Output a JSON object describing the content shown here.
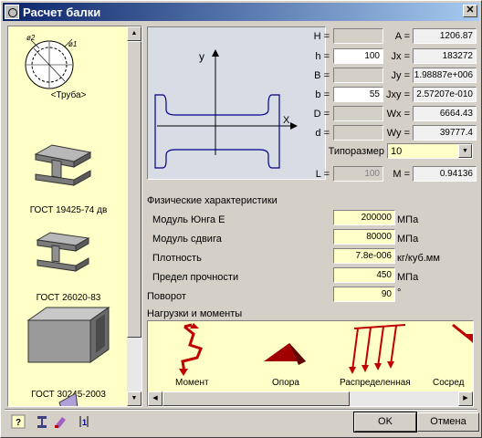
{
  "window": {
    "title": "Расчет балки"
  },
  "profiles": [
    {
      "label": "<Труба>",
      "icon": "pipe-section-icon",
      "dims": [
        "ø2",
        "ø1"
      ]
    },
    {
      "label": "ГОСТ 19425-74 дв",
      "icon": "i-beam-19425-icon"
    },
    {
      "label": "ГОСТ 26020-83",
      "icon": "i-beam-26020-icon"
    },
    {
      "label": "ГОСТ 30245-2003",
      "icon": "rect-tube-icon"
    }
  ],
  "preview": {
    "axis_x": "X",
    "axis_y": "y"
  },
  "dims": {
    "H": {
      "label": "H =",
      "value": ""
    },
    "h": {
      "label": "h =",
      "value": "100"
    },
    "B": {
      "label": "B =",
      "value": ""
    },
    "b": {
      "label": "b =",
      "value": "55"
    },
    "D": {
      "label": "D =",
      "value": ""
    },
    "d": {
      "label": "d =",
      "value": ""
    }
  },
  "props": {
    "A": {
      "label": "A =",
      "value": "1206.87"
    },
    "Jx": {
      "label": "Jx =",
      "value": "183272"
    },
    "Jy": {
      "label": "Jy =",
      "value": "1.98887e+006"
    },
    "Jxy": {
      "label": "Jxy =",
      "value": "2.57207e-010"
    },
    "Wx": {
      "label": "Wx =",
      "value": "6664.43"
    },
    "Wy": {
      "label": "Wy =",
      "value": "39777.4"
    }
  },
  "size": {
    "label": "Типоразмер",
    "value": "10"
  },
  "L": {
    "label": "L =",
    "value": "100"
  },
  "M": {
    "label": "M =",
    "value": "0.94136"
  },
  "physical": {
    "title": "Физические характеристики",
    "rows": [
      {
        "label": "Модуль Юнга E",
        "value": "200000",
        "unit": "МПа"
      },
      {
        "label": "Модуль сдвига",
        "value": "80000",
        "unit": "МПа"
      },
      {
        "label": "Плотность",
        "value": "7.8e-006",
        "unit": "кг/куб.мм"
      },
      {
        "label": "Предел прочности",
        "value": "450",
        "unit": "МПа"
      }
    ]
  },
  "rotation": {
    "label": "Поворот",
    "value": "90",
    "unit": "°"
  },
  "loads": {
    "title": "Нагрузки и моменты",
    "items": [
      {
        "label": "Момент",
        "icon": "moment-icon"
      },
      {
        "label": "Опора",
        "icon": "support-icon"
      },
      {
        "label": "Распределенная",
        "icon": "distributed-load-icon"
      },
      {
        "label": "Сосред",
        "icon": "concentrated-load-icon"
      }
    ]
  },
  "toolbar": {
    "help_icon": "?",
    "tool2_icon": "beam-icon",
    "tool3_icon": "paint-icon",
    "tool4_icon": "info-icon"
  },
  "buttons": {
    "ok": "OK",
    "cancel": "Отмена"
  },
  "colors": {
    "field_yellow": "#ffffc8",
    "title_blue": "#0a246a",
    "drawing": "#00008b"
  }
}
